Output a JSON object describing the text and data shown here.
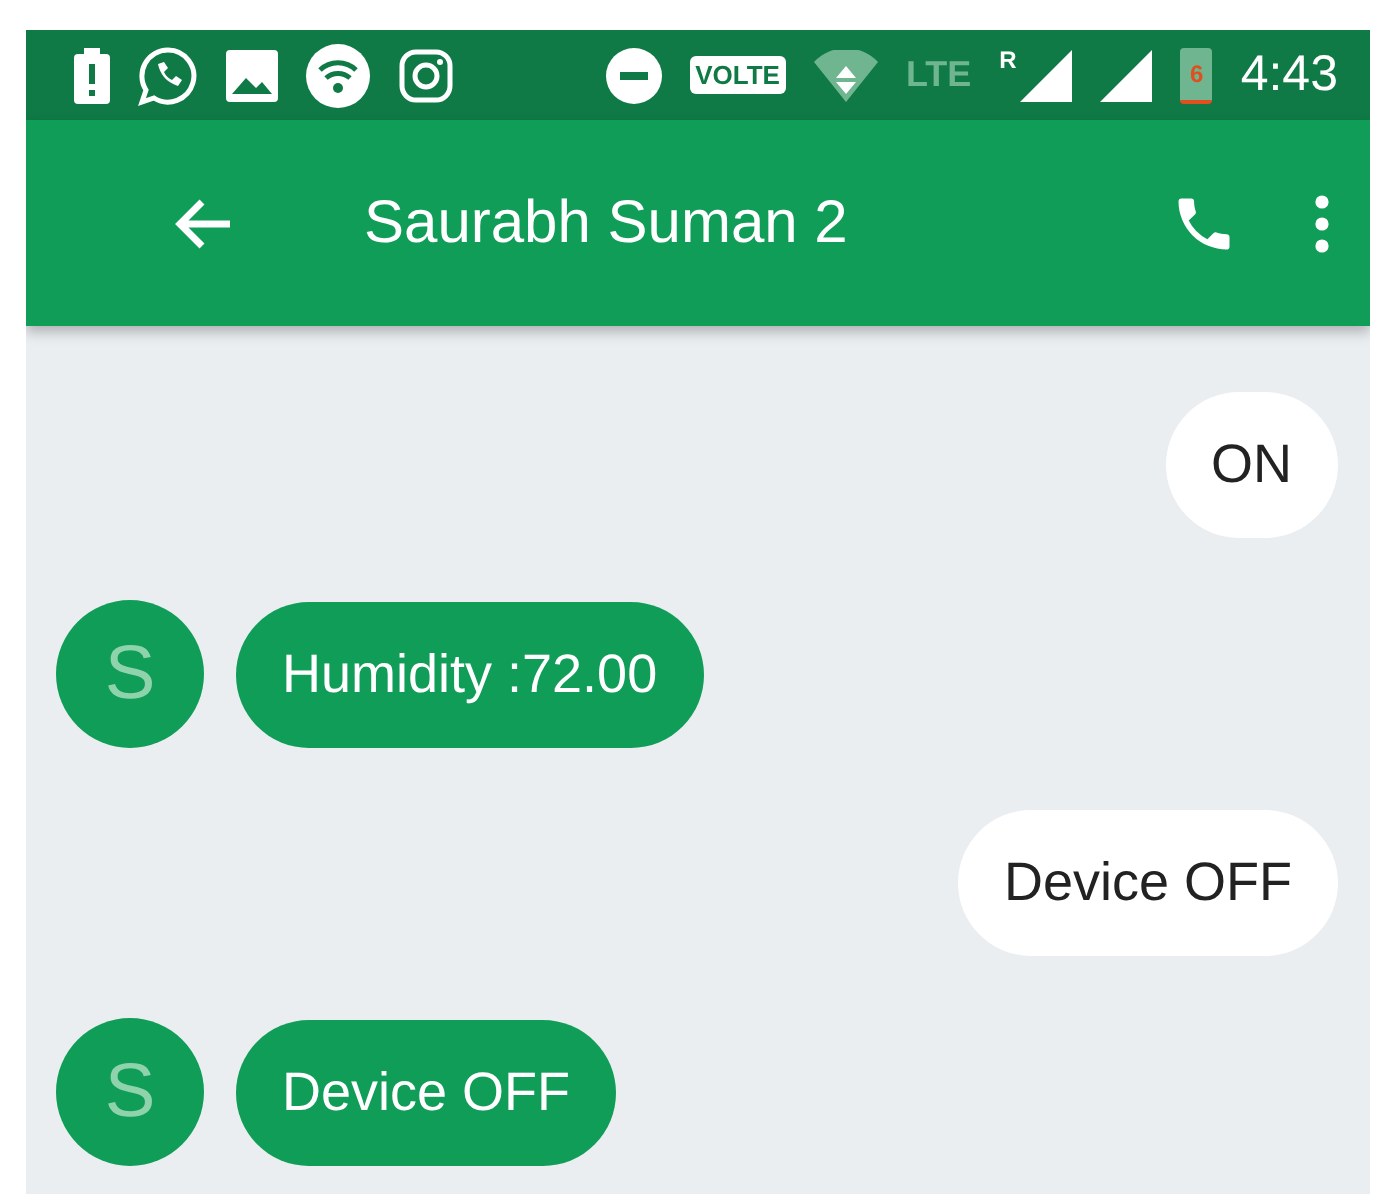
{
  "status_bar": {
    "volte": "VOLTE",
    "network": "LTE",
    "roaming": "R",
    "battery": "6",
    "time": "4:43"
  },
  "app_bar": {
    "title": "Saurabh Suman 2"
  },
  "messages": [
    {
      "kind": "sent",
      "text": "ON"
    },
    {
      "kind": "received",
      "avatar": "S",
      "text": "Humidity :72.00"
    },
    {
      "kind": "sent",
      "text": "Device OFF"
    },
    {
      "kind": "received",
      "avatar": "S",
      "text": "Device OFF"
    }
  ]
}
